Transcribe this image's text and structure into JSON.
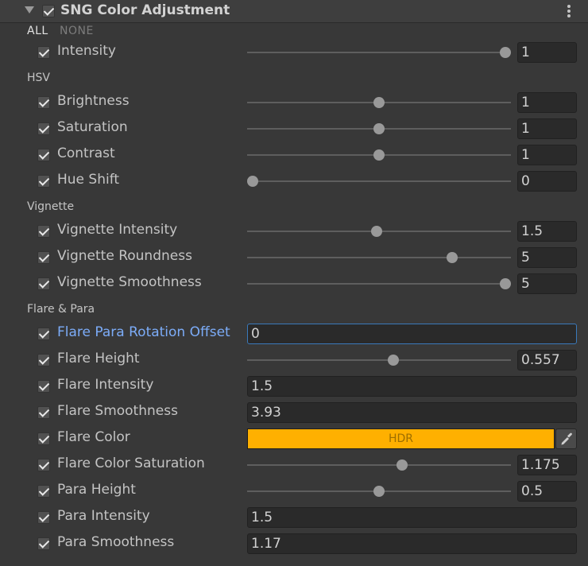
{
  "component": {
    "title": "SNG Color Adjustment",
    "enabled": true
  },
  "toggles": {
    "all": "ALL",
    "none": "NONE"
  },
  "sections": {
    "hsv": "HSV",
    "vignette": "Vignette",
    "flare": "Flare & Para"
  },
  "colors": {
    "flare_color": "#ffb000",
    "focus_label": "#7cacf8",
    "focus_border": "#3a79bb"
  },
  "icons": {
    "foldout": "triangle-down-icon",
    "menu": "kebab-menu-icon",
    "picker": "eyedropper-icon"
  },
  "properties": [
    {
      "label": "Intensity",
      "type": "slider",
      "value": "1",
      "fraction": 1.0,
      "checked": true
    },
    {
      "label": "Brightness",
      "type": "slider",
      "value": "1",
      "fraction": 0.5,
      "checked": true
    },
    {
      "label": "Saturation",
      "type": "slider",
      "value": "1",
      "fraction": 0.5,
      "checked": true
    },
    {
      "label": "Contrast",
      "type": "slider",
      "value": "1",
      "fraction": 0.5,
      "checked": true
    },
    {
      "label": "Hue Shift",
      "type": "slider",
      "value": "0",
      "fraction": 0.0,
      "checked": true
    },
    {
      "label": "Vignette Intensity",
      "type": "slider",
      "value": "1.5",
      "fraction": 0.49,
      "checked": true
    },
    {
      "label": "Vignette Roundness",
      "type": "slider",
      "value": "5",
      "fraction": 0.79,
      "checked": true
    },
    {
      "label": "Vignette Smoothness",
      "type": "slider",
      "value": "5",
      "fraction": 1.0,
      "checked": true
    },
    {
      "label": "Flare Para Rotation Offset",
      "type": "field",
      "value": "0",
      "checked": true,
      "focused": true
    },
    {
      "label": "Flare Height",
      "type": "slider",
      "value": "0.557",
      "fraction": 0.557,
      "checked": true
    },
    {
      "label": "Flare Intensity",
      "type": "field",
      "value": "1.5",
      "checked": true
    },
    {
      "label": "Flare Smoothness",
      "type": "field",
      "value": "3.93",
      "checked": true
    },
    {
      "label": "Flare Color",
      "type": "color",
      "badge": "HDR",
      "checked": true
    },
    {
      "label": "Flare Color Saturation",
      "type": "slider",
      "value": "1.175",
      "fraction": 0.59,
      "checked": true
    },
    {
      "label": "Para Height",
      "type": "slider",
      "value": "0.5",
      "fraction": 0.5,
      "checked": true
    },
    {
      "label": "Para Intensity",
      "type": "field",
      "value": "1.5",
      "checked": true
    },
    {
      "label": "Para Smoothness",
      "type": "field",
      "value": "1.17",
      "checked": true
    }
  ]
}
